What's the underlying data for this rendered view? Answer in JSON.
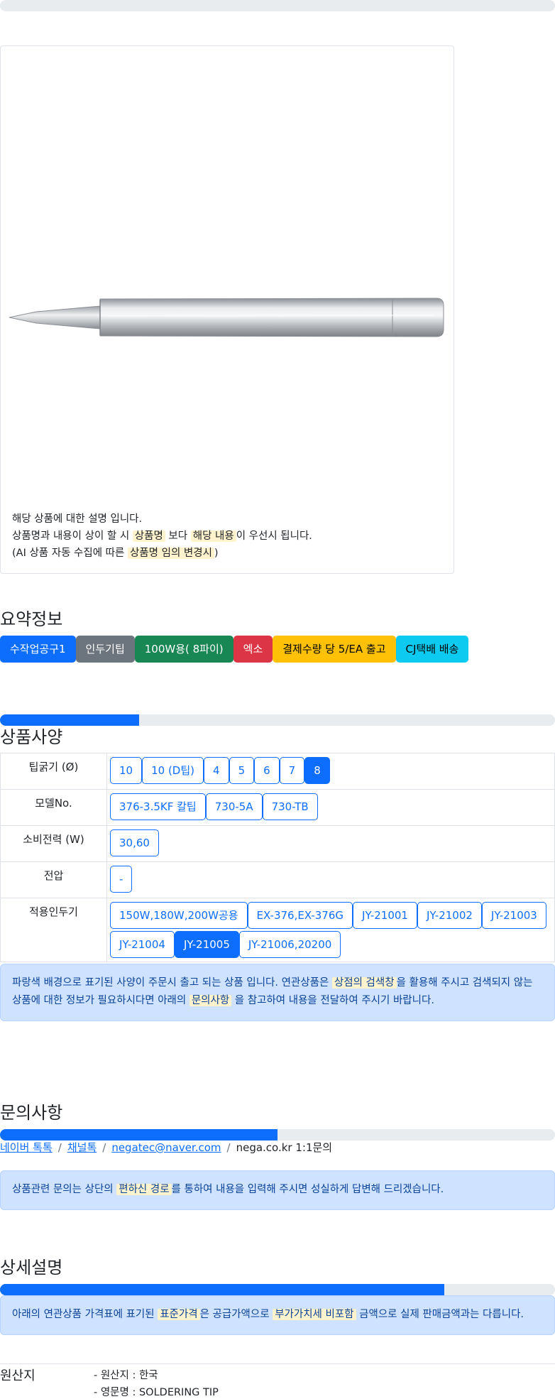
{
  "image_card": {
    "description_lines": [
      {
        "parts": [
          {
            "t": "해당 상품에 대한 설명 입니다.",
            "hl": false
          }
        ]
      },
      {
        "parts": [
          {
            "t": "상품명과 내용이 상이 할 시 ",
            "hl": false
          },
          {
            "t": "상품명",
            "hl": true
          },
          {
            "t": " 보다 ",
            "hl": false
          },
          {
            "t": "해당 내용",
            "hl": true
          },
          {
            "t": "이 우선시 됩니다.",
            "hl": false
          }
        ]
      },
      {
        "parts": [
          {
            "t": "(AI 상품 자동 수집에 따른 ",
            "hl": false
          },
          {
            "t": "상품명 임의 변경시",
            "hl": true
          },
          {
            "t": ")",
            "hl": false
          }
        ]
      }
    ]
  },
  "summary": {
    "title": "요약정보",
    "badges": [
      {
        "label": "수작업공구1",
        "color": "blue"
      },
      {
        "label": "인두기팁",
        "color": "gray"
      },
      {
        "label": "100W용( 8파이)",
        "color": "green"
      },
      {
        "label": "엑소",
        "color": "red"
      },
      {
        "label": "결제수량 당 5/EA 출고",
        "color": "yellow"
      },
      {
        "label": "CJ택배 배송",
        "color": "cyan"
      }
    ]
  },
  "specs": {
    "title": "상품사양",
    "progress": 0.25,
    "rows": [
      {
        "label": "팁굵기 (Ø)",
        "options": [
          {
            "v": "10",
            "active": false
          },
          {
            "v": "10 (D팁)",
            "active": false
          },
          {
            "v": "4",
            "active": false
          },
          {
            "v": "5",
            "active": false
          },
          {
            "v": "6",
            "active": false
          },
          {
            "v": "7",
            "active": false
          },
          {
            "v": "8",
            "active": true
          }
        ]
      },
      {
        "label": "모델No.",
        "options": [
          {
            "v": "376-3.5KF 칼팁",
            "active": false
          },
          {
            "v": "730-5A",
            "active": false
          },
          {
            "v": "730-TB",
            "active": false
          }
        ]
      },
      {
        "label": "소비전력 (W)",
        "options": [
          {
            "v": "30,60",
            "active": false
          }
        ]
      },
      {
        "label": "전압",
        "options": [
          {
            "v": "-",
            "active": false
          }
        ]
      },
      {
        "label": "적용인두기",
        "options": [
          {
            "v": "150W,180W,200W공용",
            "active": false
          },
          {
            "v": "EX-376,EX-376G",
            "active": false
          },
          {
            "v": "JY-21001",
            "active": false
          },
          {
            "v": "JY-21002",
            "active": false
          },
          {
            "v": "JY-21003",
            "active": false
          },
          {
            "v": "JY-21004",
            "active": false
          },
          {
            "v": "JY-21005",
            "active": true
          },
          {
            "v": "JY-21006,20200",
            "active": false
          }
        ]
      }
    ],
    "notice": [
      {
        "t": "파랑색 배경으로 표기된 사양이 주문시 출고 되는 상품 입니다. 연관상품은 ",
        "hl": false
      },
      {
        "t": "상점의 검색창",
        "hl": true
      },
      {
        "t": "을 활용해 주시고 검색되지 않는 상품에 대한 정보가 필요하시다면 아래의 ",
        "hl": false
      },
      {
        "t": "문의사항",
        "hl": true
      },
      {
        "t": " 을 참고하여 내용을 전달하여 주시기 바랍니다.",
        "hl": false
      }
    ]
  },
  "inquiry": {
    "title": "문의사항",
    "progress": 0.5,
    "links": [
      {
        "label": "네이버 톡톡",
        "link": true
      },
      {
        "label": "채널톡",
        "link": true
      },
      {
        "label": "negatec@naver.com",
        "link": true
      },
      {
        "label": "nega.co.kr 1:1문의",
        "link": false
      }
    ],
    "separator": "/",
    "notice": [
      {
        "t": "상품관련 문의는 상단의 ",
        "hl": false
      },
      {
        "t": "편하신 경로",
        "hl": true
      },
      {
        "t": "를 통하여 내용을 입력해 주시면 성실하게 답변해 드리겠습니다.",
        "hl": false
      }
    ]
  },
  "detail": {
    "title": "상세설명",
    "progress": 0.8,
    "notice": [
      {
        "t": "아래의 연관상품 가격표에 표기된 ",
        "hl": false
      },
      {
        "t": "표준가격",
        "hl": true
      },
      {
        "t": "은 공급가액으로 ",
        "hl": false
      },
      {
        "t": "부가가치세 비포함",
        "hl": true
      },
      {
        "t": " 금액으로 실제 판매금액과는 다릅니다.",
        "hl": false
      }
    ]
  },
  "origin": {
    "label": "원산지",
    "values": [
      "- 원산지 : 한국",
      "- 영문명 : SOLDERING TIP"
    ]
  }
}
